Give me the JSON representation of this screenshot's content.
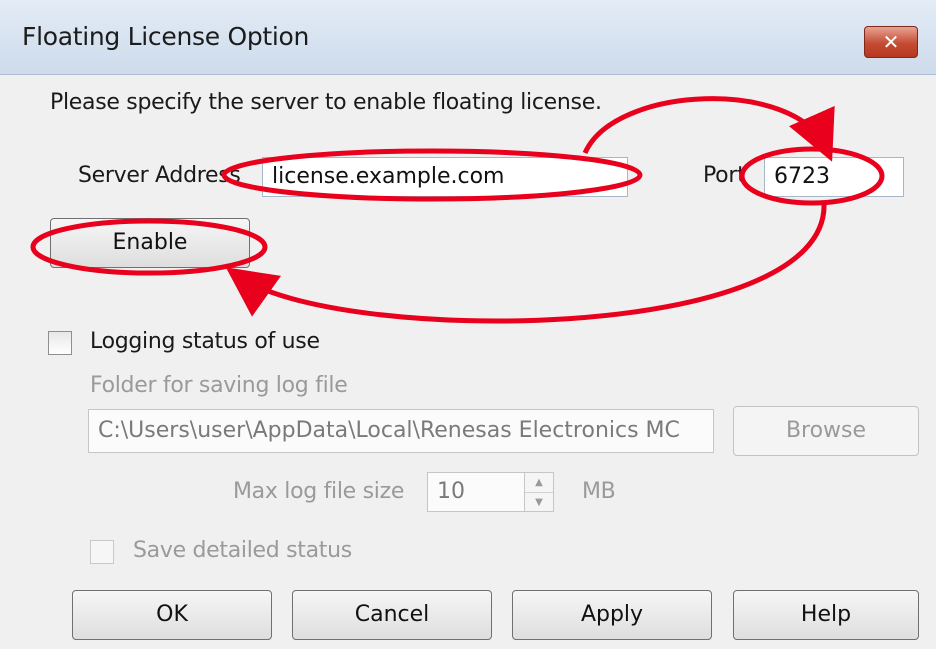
{
  "window": {
    "title": "Floating License Option",
    "close_glyph": "✕"
  },
  "instructions": "Please specify the server to enable floating license.",
  "server": {
    "address_label": "Server Address",
    "address_value": "license.example.com",
    "port_label": "Port",
    "port_value": "6723"
  },
  "enable_button": "Enable",
  "logging": {
    "checkbox_label": "Logging status of use",
    "checked": false,
    "folder_label": "Folder for saving log file",
    "folder_value": "C:\\Users\\user\\AppData\\Local\\Renesas Electronics MC",
    "browse_button": "Browse",
    "max_size_label": "Max log file size",
    "max_size_value": "10",
    "max_size_unit": "MB",
    "save_detailed_label": "Save detailed status"
  },
  "footer": {
    "ok": "OK",
    "cancel": "Cancel",
    "apply": "Apply",
    "help": "Help"
  },
  "icons": {
    "spin_up": "▲",
    "spin_down": "▼"
  },
  "colors": {
    "annotation_red": "#e8001c",
    "title_bar": "#d8e4f1",
    "close_button": "#c44b33"
  }
}
